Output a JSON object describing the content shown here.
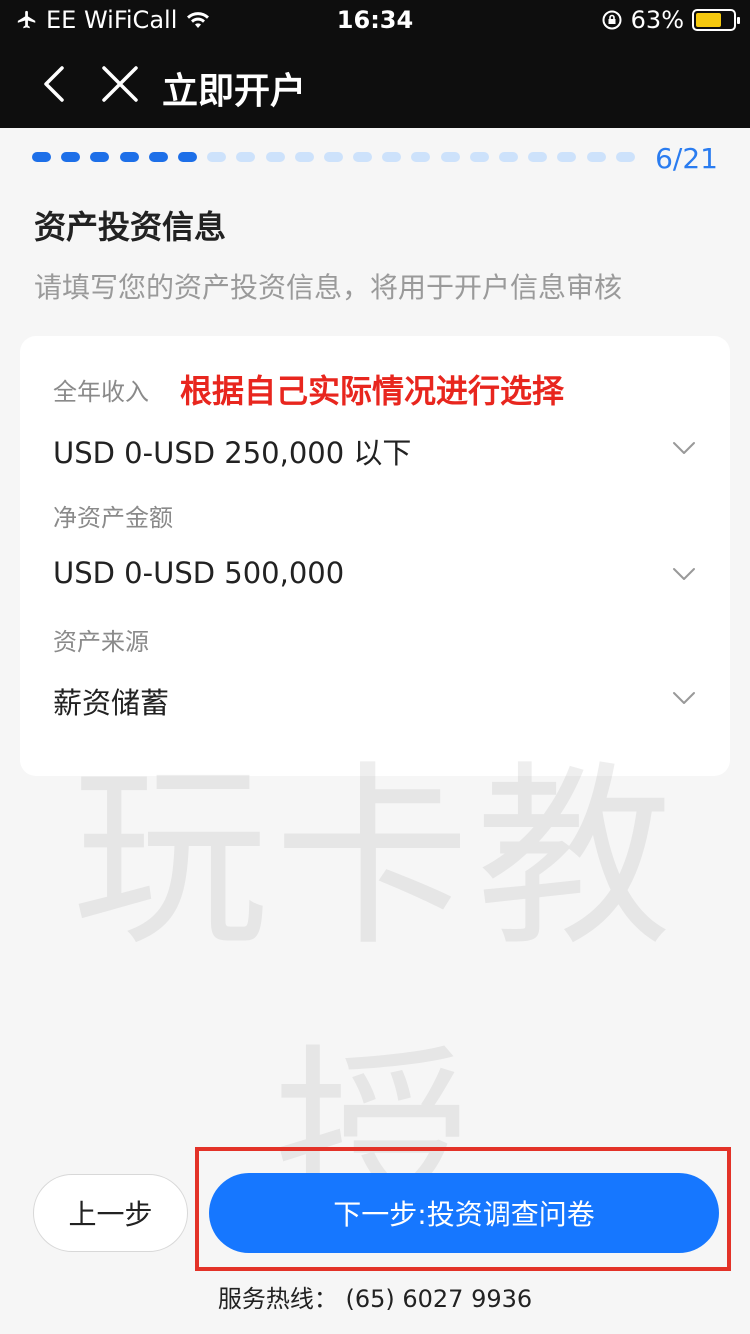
{
  "status_bar": {
    "carrier": "EE WiFiCall",
    "time": "16:34",
    "battery": "63%",
    "battery_level": 0.63
  },
  "nav": {
    "title": "立即开户"
  },
  "progress": {
    "current": 6,
    "total": 21,
    "label": "6/21"
  },
  "section": {
    "title": "资产投资信息",
    "subtitle": "请填写您的资产投资信息，将用于开户信息审核"
  },
  "fields": [
    {
      "label": "全年收入",
      "value": "USD 0-USD 250,000 以下"
    },
    {
      "label": "净资产金额",
      "value": "USD 0-USD 500,000"
    },
    {
      "label": "资产来源",
      "value": "薪资储蓄"
    }
  ],
  "annotation": "根据自己实际情况进行选择",
  "watermark": "玩卡教授",
  "buttons": {
    "prev": "上一步",
    "next": "下一步:投资调查问卷"
  },
  "hotline": "服务热线：  (65) 6027 9936",
  "colors": {
    "accent": "#1677ff",
    "highlight": "#e33228",
    "annotation": "#e8261e"
  }
}
